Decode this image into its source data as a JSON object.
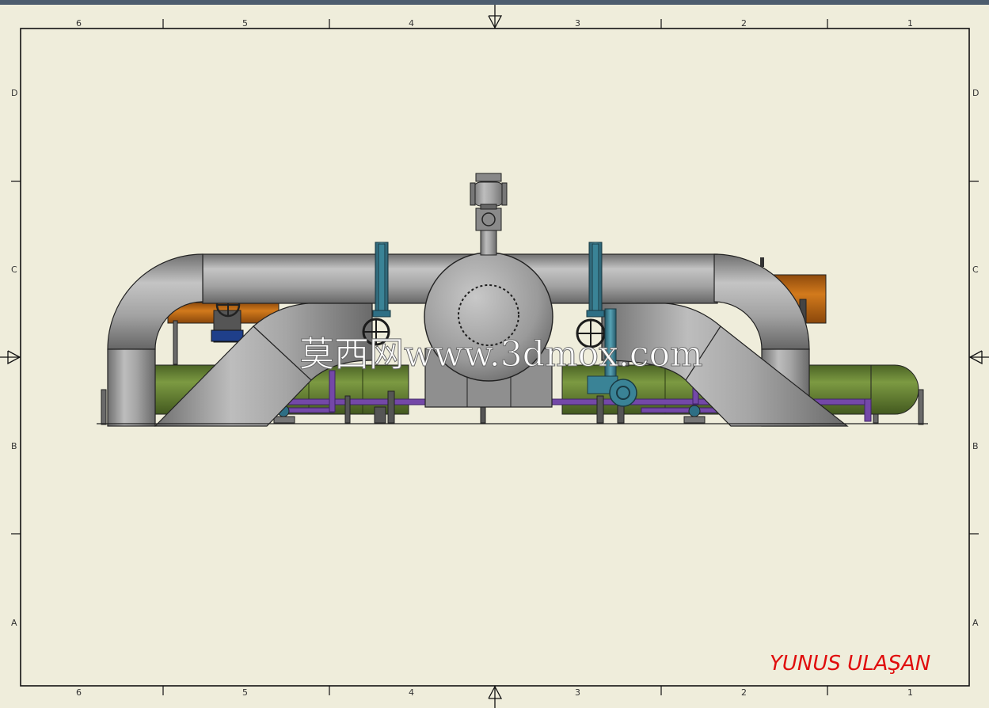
{
  "sheet": {
    "column_labels_top": [
      "6",
      "5",
      "4",
      "3",
      "2",
      "1"
    ],
    "column_labels_bottom": [
      "6",
      "5",
      "4",
      "3",
      "2",
      "1"
    ],
    "row_labels_left": [
      "D",
      "C",
      "B",
      "A"
    ],
    "row_labels_right": [
      "D",
      "C",
      "B",
      "A"
    ]
  },
  "watermark": "莫西网www.3dmox.com",
  "author": "YUNUS ULAŞAN",
  "colors": {
    "background": "#efeddb",
    "pipe_gray": "#9c9c9c",
    "tank_green": "#5f7a30",
    "tank_orange": "#b45f10",
    "pipe_purple": "#6b3fa0",
    "valve_teal": "#3c7f8f",
    "title_text": "#e00d0d"
  },
  "icons": [
    "centering-arrow-top-icon",
    "centering-arrow-bottom-icon",
    "centering-arrow-left-icon",
    "centering-arrow-right-icon",
    "handwheel-icon",
    "manhole-flange-icon"
  ]
}
